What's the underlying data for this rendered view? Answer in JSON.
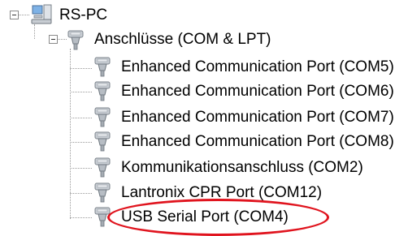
{
  "tree": {
    "root": {
      "label": "RS-PC",
      "icon": "computer-icon"
    },
    "category": {
      "label": "Anschlüsse (COM & LPT)",
      "icon": "port-connector-icon"
    },
    "items": [
      {
        "label": "Enhanced Communication Port (COM5)",
        "icon": "port-connector-icon"
      },
      {
        "label": "Enhanced Communication Port (COM6)",
        "icon": "port-connector-icon"
      },
      {
        "label": "Enhanced Communication Port (COM7)",
        "icon": "port-connector-icon"
      },
      {
        "label": "Enhanced Communication Port (COM8)",
        "icon": "port-connector-icon"
      },
      {
        "label": "Kommunikationsanschluss (COM2)",
        "icon": "port-connector-icon"
      },
      {
        "label": "Lantronix CPR Port (COM12)",
        "icon": "port-connector-icon"
      },
      {
        "label": "USB Serial Port (COM4)",
        "icon": "port-connector-icon"
      }
    ]
  },
  "annotation": {
    "color": "#e0141e",
    "target": "USB Serial Port (COM4)"
  }
}
